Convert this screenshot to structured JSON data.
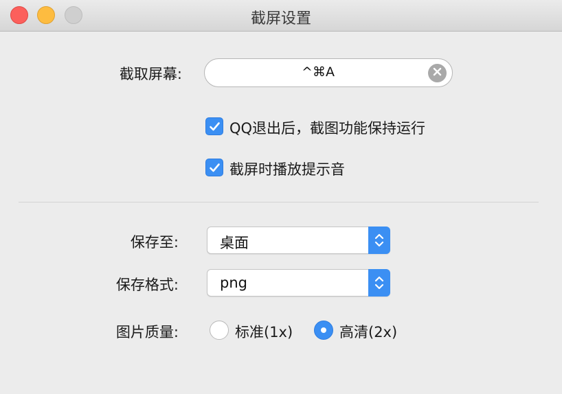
{
  "window": {
    "title": "截屏设置"
  },
  "shortcut": {
    "label": "截取屏幕:",
    "value": "^⌘A"
  },
  "options": [
    {
      "label": "QQ退出后，截图功能保持运行",
      "checked": true
    },
    {
      "label": "截屏时播放提示音",
      "checked": true
    }
  ],
  "save_to": {
    "label": "保存至:",
    "value": "桌面"
  },
  "save_format": {
    "label": "保存格式:",
    "value": "png"
  },
  "quality": {
    "label": "图片质量:",
    "options": [
      {
        "label": "标准(1x)",
        "selected": false
      },
      {
        "label": "高清(2x)",
        "selected": true
      }
    ]
  },
  "colors": {
    "accent": "#3b8ff3",
    "close": "#fc605c",
    "minimize": "#fdbc40"
  }
}
